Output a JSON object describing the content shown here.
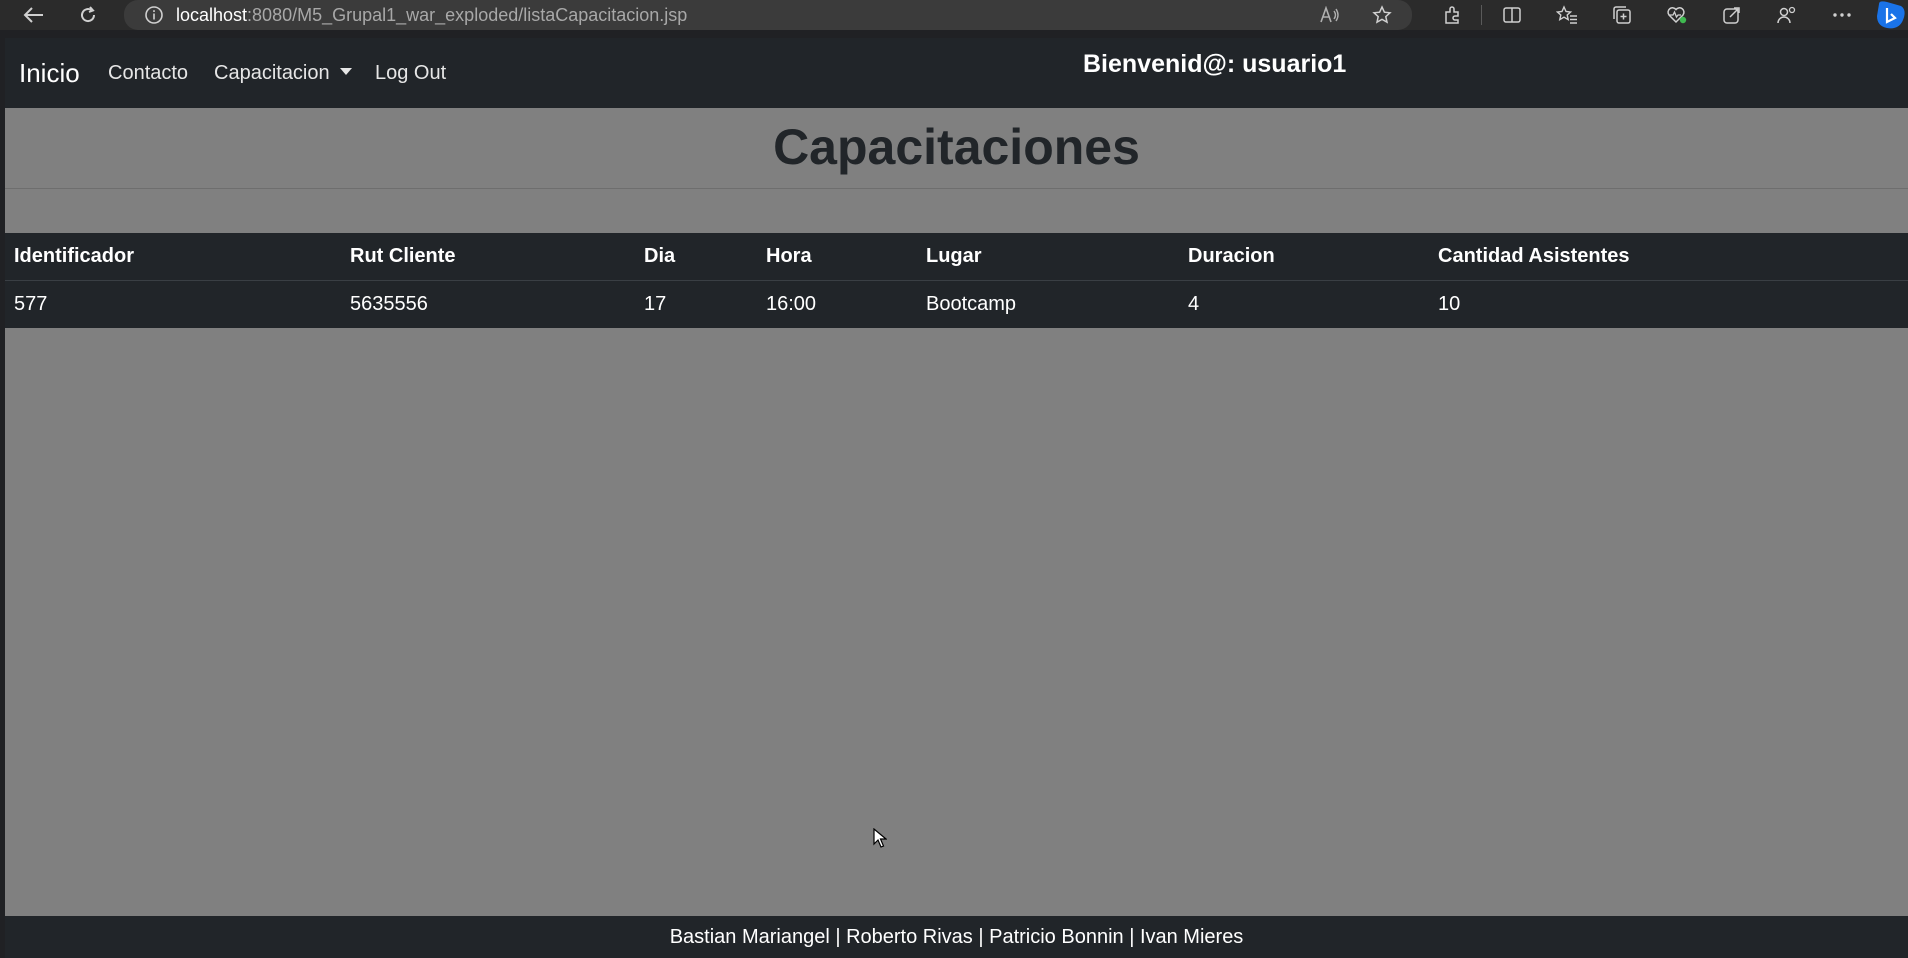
{
  "browser": {
    "url_host": "localhost",
    "url_path": ":8080/M5_Grupal1_war_exploded/listaCapacitacion.jsp",
    "icons": [
      "back-icon",
      "refresh-icon",
      "info-icon",
      "read-aloud-icon",
      "favorite-star-icon",
      "extensions-icon",
      "split-screen-icon",
      "favorites-icon",
      "collections-icon",
      "performance-icon",
      "copilot-icon",
      "profile-icon",
      "more-icon",
      "bing-icon"
    ]
  },
  "navbar": {
    "brand": "Inicio",
    "links": {
      "contacto": "Contacto",
      "capacitacion": "Capacitacion",
      "logout": "Log Out"
    },
    "welcome": "Bienvenid@: usuario1"
  },
  "main": {
    "title": "Capacitaciones"
  },
  "table": {
    "headers": [
      "Identificador",
      "Rut Cliente",
      "Dia",
      "Hora",
      "Lugar",
      "Duracion",
      "Cantidad Asistentes"
    ],
    "rows": [
      [
        "577",
        "5635556",
        "17",
        "16:00",
        "Bootcamp",
        "4",
        "10"
      ]
    ]
  },
  "footer": {
    "text": "Bastian Mariangel | Roberto Rivas | Patricio Bonnin | Ivan Mieres"
  },
  "colors": {
    "navbar_bg": "#212529",
    "page_bg": "#808080",
    "title_color": "#212529"
  }
}
